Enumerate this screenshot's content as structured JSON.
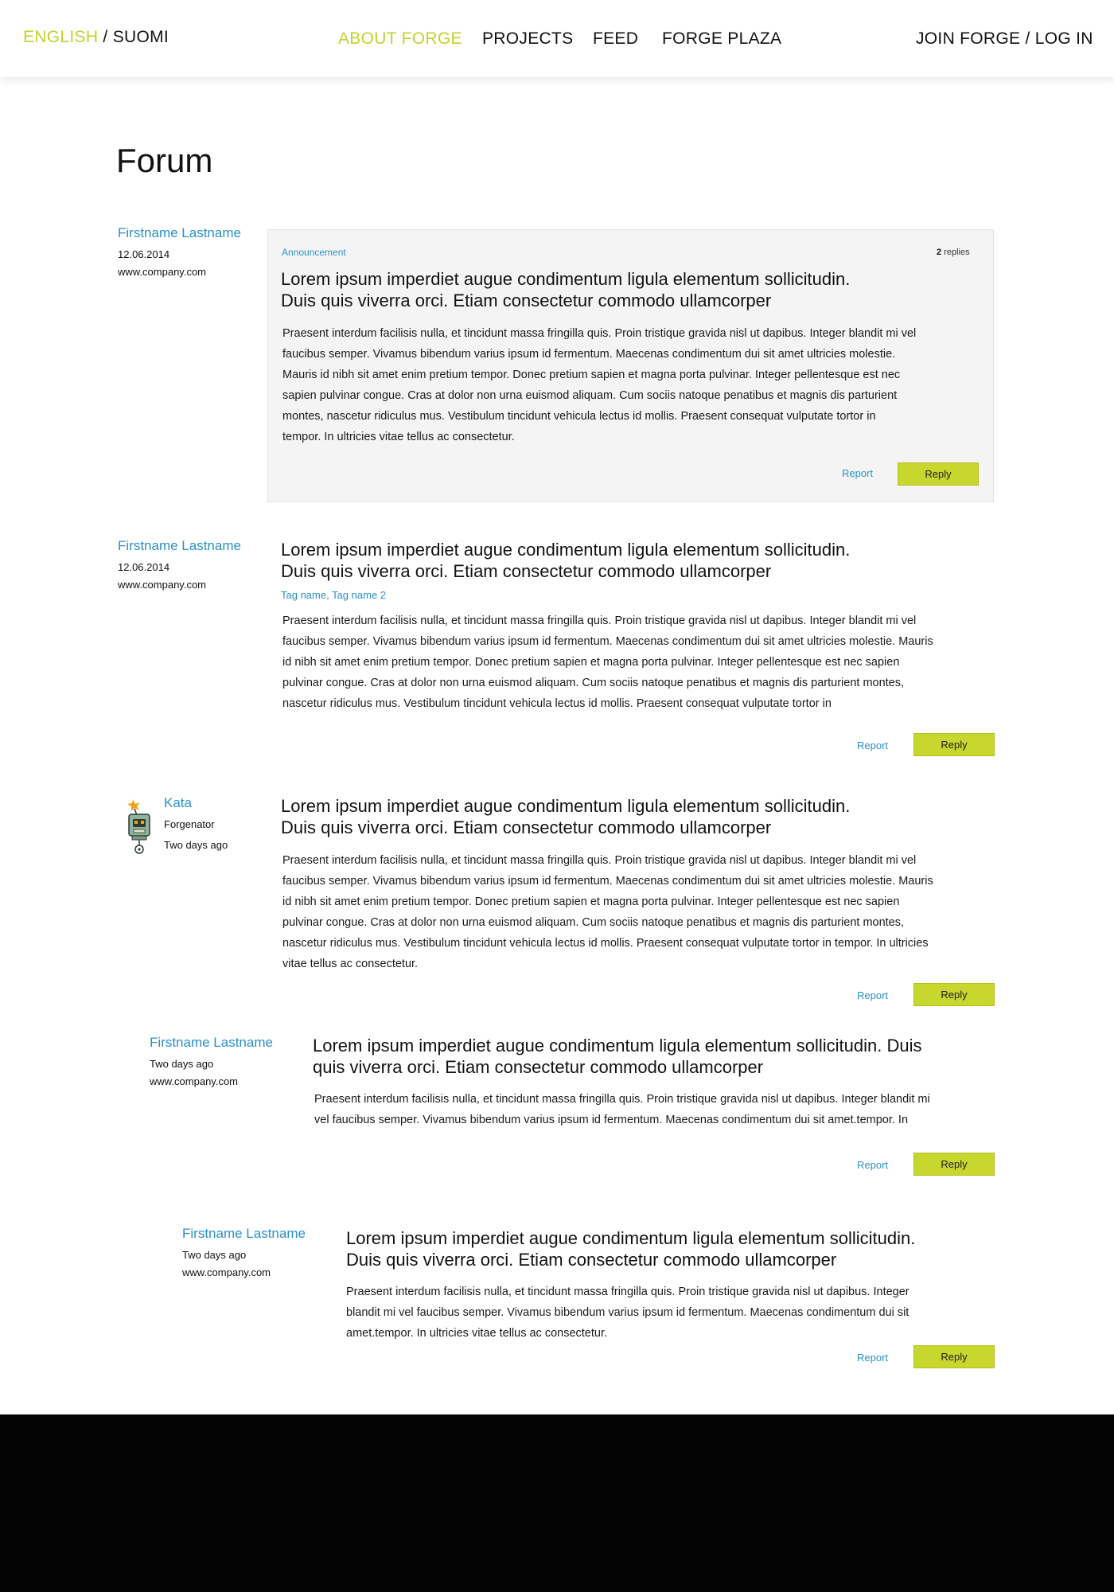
{
  "header": {
    "lang_active": "ENGLISH",
    "lang_separator": " / ",
    "lang_other": "SUOMI",
    "nav": {
      "about": "ABOUT FORGE",
      "projects": "PROJECTS",
      "feed": "FEED",
      "plaza": "FORGE PLAZA",
      "join": "JOIN FORGE / LOG IN"
    }
  },
  "page_title": "Forum",
  "colors": {
    "accent_green": "#c4d22d",
    "link_blue": "#2a91c9",
    "button_green": "#c8d72d"
  },
  "posts": [
    {
      "author": "Firstname Lastname",
      "date": "12.06.2014",
      "site": "www.company.com",
      "label": "Announcement",
      "replies_count": "2",
      "replies_text": " replies",
      "title_line1": "Lorem ipsum imperdiet augue condimentum ligula elementum sollicitudin.",
      "title_line2": "Duis quis viverra orci. Etiam consectetur commodo ullamcorper",
      "body": [
        "Praesent interdum facilisis nulla, et tincidunt massa fringilla quis. Proin tristique gravida nisl ut dapibus. Integer blandit mi vel",
        "faucibus semper. Vivamus bibendum varius ipsum id fermentum. Maecenas condimentum dui sit amet ultricies molestie.",
        "Mauris id nibh sit amet enim pretium tempor. Donec pretium sapien et magna porta pulvinar. Integer pellentesque est nec",
        "sapien pulvinar congue. Cras at dolor non urna euismod aliquam. Cum sociis natoque penatibus et magnis dis parturient",
        "montes, nascetur ridiculus mus. Vestibulum tincidunt vehicula lectus id mollis. Praesent consequat vulputate tortor in",
        "tempor. In ultricies vitae tellus ac consectetur."
      ],
      "report": "Report",
      "reply": "Reply"
    },
    {
      "author": "Firstname Lastname",
      "date": "12.06.2014",
      "site": "www.company.com",
      "title_line1": "Lorem ipsum imperdiet augue condimentum ligula elementum sollicitudin.",
      "title_line2": "Duis quis viverra orci. Etiam consectetur commodo ullamcorper",
      "tags": "Tag name, Tag name 2",
      "body": [
        "Praesent interdum facilisis nulla, et tincidunt massa fringilla quis. Proin tristique gravida nisl ut dapibus. Integer blandit mi vel",
        "faucibus semper. Vivamus bibendum varius ipsum id fermentum. Maecenas condimentum dui sit amet ultricies molestie. Mauris",
        "id nibh sit amet enim pretium tempor. Donec pretium sapien et magna porta pulvinar. Integer pellentesque est nec sapien",
        "pulvinar congue. Cras at dolor non urna euismod aliquam. Cum sociis natoque penatibus et magnis dis parturient montes,",
        "nascetur ridiculus mus. Vestibulum tincidunt vehicula lectus id mollis. Praesent consequat vulputate tortor in"
      ],
      "report": "Report",
      "reply": "Reply"
    },
    {
      "author": "Kata",
      "role": "Forgenator",
      "time": "Two days ago",
      "avatar_icon": "robot-avatar-icon",
      "title_line1": "Lorem ipsum imperdiet augue condimentum ligula elementum sollicitudin.",
      "title_line2": "Duis quis viverra orci. Etiam consectetur commodo ullamcorper",
      "body": [
        "Praesent interdum facilisis nulla, et tincidunt massa fringilla quis. Proin tristique gravida nisl ut dapibus. Integer blandit mi vel",
        "faucibus semper. Vivamus bibendum varius ipsum id fermentum. Maecenas condimentum dui sit amet ultricies molestie. Mauris",
        "id nibh sit amet enim pretium tempor. Donec pretium sapien et magna porta pulvinar. Integer pellentesque est nec sapien",
        "pulvinar congue. Cras at dolor non urna euismod aliquam. Cum sociis natoque penatibus et magnis dis parturient montes,",
        "nascetur ridiculus mus. Vestibulum tincidunt vehicula lectus id mollis. Praesent consequat vulputate tortor in tempor. In ultricies",
        "vitae tellus ac consectetur."
      ],
      "report": "Report",
      "reply": "Reply"
    },
    {
      "author": "Firstname Lastname",
      "time": "Two days ago",
      "site": "www.company.com",
      "title_line1": "Lorem ipsum imperdiet augue condimentum ligula elementum sollicitudin. Duis",
      "title_line2": "quis viverra orci. Etiam consectetur commodo ullamcorper",
      "body": [
        "Praesent interdum facilisis nulla, et tincidunt massa fringilla quis. Proin tristique gravida nisl ut dapibus. Integer blandit mi",
        "vel faucibus semper. Vivamus bibendum varius ipsum id fermentum. Maecenas condimentum dui sit amet.tempor. In"
      ],
      "report": "Report",
      "reply": "Reply"
    },
    {
      "author": "Firstname Lastname",
      "time": "Two days ago",
      "site": "www.company.com",
      "title_line1": "Lorem ipsum imperdiet augue condimentum ligula elementum sollicitudin.",
      "title_line2": "Duis quis viverra orci. Etiam consectetur commodo ullamcorper",
      "body": [
        "Praesent interdum facilisis nulla, et tincidunt massa fringilla quis. Proin tristique gravida nisl ut dapibus. Integer",
        "blandit mi vel faucibus semper. Vivamus bibendum varius ipsum id fermentum. Maecenas condimentum dui sit",
        "amet.tempor. In ultricies vitae tellus ac consectetur."
      ],
      "report": "Report",
      "reply": "Reply"
    }
  ]
}
